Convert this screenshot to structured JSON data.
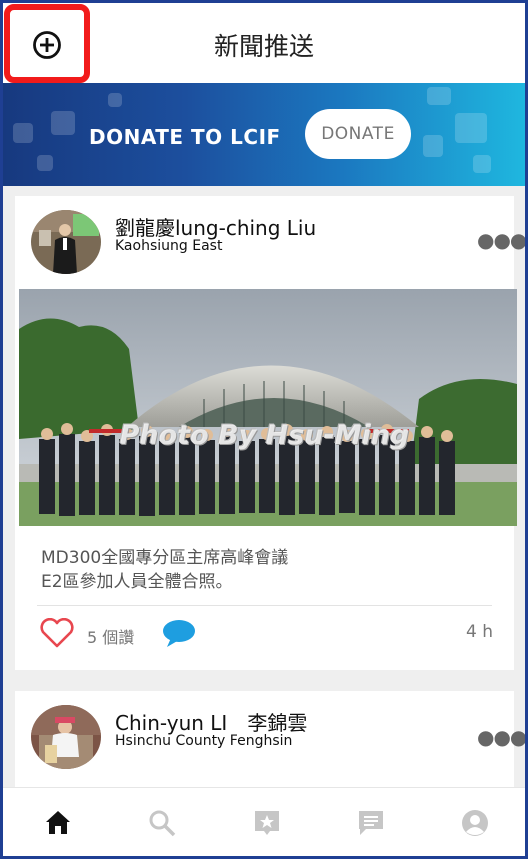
{
  "header": {
    "title": "新聞推送",
    "add_icon": "plus-circle-icon"
  },
  "banner": {
    "label": "DONATE TO LCIF",
    "button_label": "DONATE"
  },
  "posts": [
    {
      "author": "劉龍慶lung-ching Liu",
      "club": "Kaohsiung East",
      "watermark": "Photo By Hsu-Ming",
      "caption": "MD300全國專分區主席高峰會議\nE2區參加人員全體合照。",
      "likes": "5 個讚",
      "time": "4 h"
    },
    {
      "author": "Chin-yun LI　李錦雲",
      "club": "Hsinchu County Fenghsin"
    }
  ],
  "tabbar": [
    "home-icon",
    "search-icon",
    "star-badge-icon",
    "chat-icon",
    "profile-icon"
  ],
  "colors": {
    "accent_red": "#f21b1b",
    "frame_blue": "#1f3f93",
    "comment_blue": "#1e9ee0",
    "like_red": "#e8474f"
  }
}
